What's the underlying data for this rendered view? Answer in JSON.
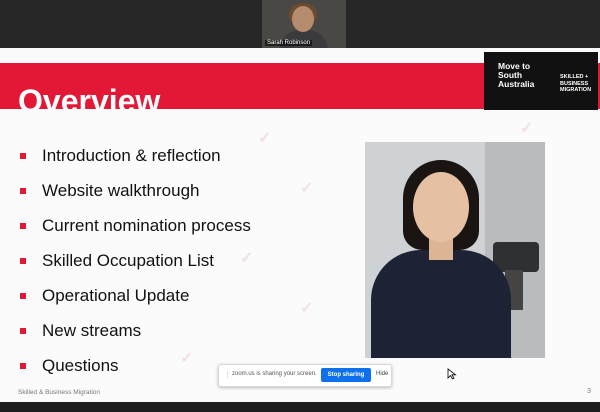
{
  "meeting": {
    "participant_name": "Sarah Robinson"
  },
  "slide": {
    "title": "Overview",
    "logo": {
      "main": "Move to South Australia",
      "sub": "SKILLED + BUSINESS MIGRATION"
    },
    "bullets": [
      "Introduction & reflection",
      "Website walkthrough",
      "Current nomination process",
      "Skilled Occupation List",
      "Operational Update",
      "New streams",
      "Questions"
    ],
    "footer": "Skilled & Business Migration",
    "page_number": "3"
  },
  "share_bar": {
    "message": "zoom.us is sharing your screen.",
    "stop_label": "Stop sharing",
    "hide_label": "Hide"
  },
  "colors": {
    "brand_red": "#e31837",
    "zoom_blue": "#0e71eb"
  }
}
